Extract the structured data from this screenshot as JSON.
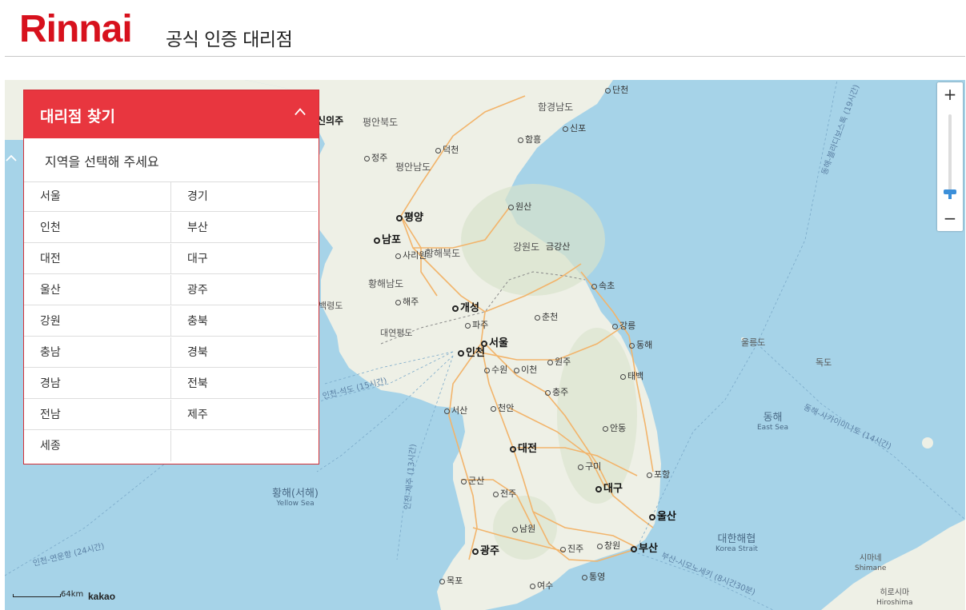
{
  "header": {
    "logo": "Rinnai",
    "subtitle": "공식 인증 대리점"
  },
  "panel": {
    "title": "대리점 찾기",
    "prompt": "지역을 선택해 주세요",
    "regions": [
      "서울",
      "경기",
      "인천",
      "부산",
      "대전",
      "대구",
      "울산",
      "광주",
      "강원",
      "충북",
      "충남",
      "경북",
      "경남",
      "전북",
      "전남",
      "제주",
      "세종",
      ""
    ]
  },
  "map": {
    "zoom_in": "+",
    "zoom_out": "−",
    "scale": "64km",
    "attribution": "kakao",
    "regions": [
      "평안북도",
      "함경남도",
      "평안남도",
      "강원도",
      "황해북도",
      "황해남도"
    ],
    "cities_major": [
      "평양",
      "남포",
      "개성",
      "서울",
      "인천",
      "대전",
      "대구",
      "울산",
      "광주",
      "부산"
    ],
    "cities": [
      "단천",
      "신포",
      "함흥",
      "신의주",
      "덕천",
      "정주",
      "원산",
      "금강산",
      "사리원",
      "해주",
      "속초",
      "춘천",
      "파주",
      "강릉",
      "동해",
      "원주",
      "수원",
      "이천",
      "태백",
      "충주",
      "서산",
      "천안",
      "안동",
      "구미",
      "포항",
      "군산",
      "전주",
      "남원",
      "진주",
      "창원",
      "목포",
      "여수",
      "통영"
    ],
    "islands": [
      "울릉도",
      "독도",
      "대연평도",
      "백령도"
    ],
    "seas": [
      {
        "name": "동해",
        "en": "East Sea"
      },
      {
        "name": "황해(서해)",
        "en": "Yellow Sea"
      },
      {
        "name": "대한해협",
        "en": "Korea Strait"
      }
    ],
    "japan": [
      {
        "name": "시마네",
        "en": "Shimane"
      },
      {
        "name": "히로시마",
        "en": "Hiroshima"
      }
    ],
    "routes": [
      "동해-블라디보스톡 (19시간)",
      "동해-사카이미나토 (14시간)",
      "부산-시모노세키 (8시간30분)",
      "인천-연운항 (24시간)",
      "인천-석도 (15시간)",
      "인천-제주 (13시간)"
    ],
    "colors": {
      "sea": "#a6d3e8",
      "land": "#eef0e6",
      "road": "#f2b46b",
      "accent": "#e8363f"
    }
  }
}
